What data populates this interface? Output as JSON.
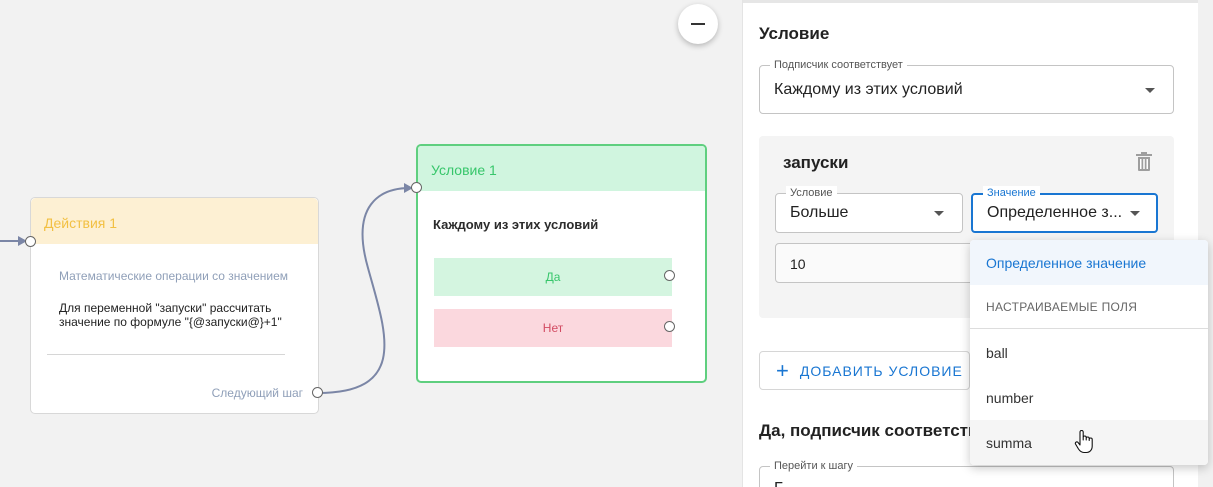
{
  "canvas": {
    "action_node": {
      "title": "Действия 1",
      "operation_title": "Математические операции со значением",
      "operation_desc": "Для переменной \"запуски\" рассчитать значение по формуле \"{@запуски@}+1\"",
      "next_step_label": "Следующий шаг"
    },
    "condition_node": {
      "title": "Условие 1",
      "match_text": "Каждому из этих условий",
      "yes_label": "Да",
      "no_label": "Нет"
    },
    "colors": {
      "action_header_bg": "#fdf0d3",
      "action_title": "#f2c043",
      "condition_border": "#5fcf7f",
      "condition_header_bg": "#d0f5df",
      "yes_bg": "#d4f5e0",
      "no_bg": "#fbd8de",
      "edge": "#7b86a6"
    }
  },
  "panel": {
    "title": "Условие",
    "subscriber_match": {
      "label": "Подписчик соответствует",
      "value": "Каждому из этих условий"
    },
    "rule": {
      "name": "запуски",
      "condition": {
        "label": "Условие",
        "value": "Больше"
      },
      "value_type": {
        "label": "Значение",
        "value": "Определенное з..."
      },
      "value_input": "10"
    },
    "add_condition_label": "ДОБАВИТЬ УСЛОВИЕ",
    "yes_section_title": "Да, подписчик соответств",
    "goto_step_label": "Перейти к шагу",
    "goto_step_value": "Г"
  },
  "dropdown": {
    "selected": "Определенное значение",
    "subheader": "НАСТРАИВАЕМЫЕ ПОЛЯ",
    "items": [
      "ball",
      "number",
      "summa"
    ]
  },
  "icons": {
    "zoom": "minus-icon",
    "trash": "trash-icon",
    "add": "plus-icon",
    "cursor": "hand-pointer-icon"
  }
}
